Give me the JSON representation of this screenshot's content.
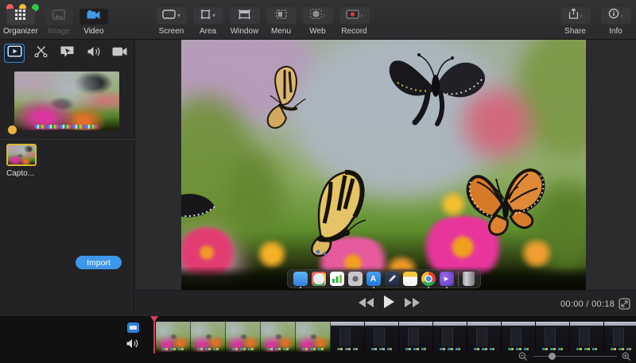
{
  "window": {
    "traffic_lights": {
      "close": "#f5615d",
      "minimize": "#f6bd3b",
      "zoom": "#33c748"
    }
  },
  "toolbar": {
    "tabs": [
      {
        "label": "Organizer",
        "icon": "grid-icon",
        "active": false
      },
      {
        "label": "Image",
        "icon": "image-icon",
        "active": false,
        "disabled": true
      },
      {
        "label": "Video",
        "icon": "video-camera-icon",
        "active": true
      }
    ],
    "capture_buttons": [
      {
        "label": "Screen",
        "icon": "screen-capture-icon",
        "has_dropdown": true
      },
      {
        "label": "Area",
        "icon": "area-capture-icon",
        "has_dropdown": true
      },
      {
        "label": "Window",
        "icon": "window-capture-icon",
        "has_dropdown": false
      },
      {
        "label": "Menu",
        "icon": "menu-capture-icon",
        "has_dropdown": false
      },
      {
        "label": "Web",
        "icon": "web-capture-icon",
        "has_dropdown": true
      },
      {
        "label": "Record",
        "icon": "record-icon",
        "has_dropdown": true
      }
    ],
    "right_buttons": [
      {
        "label": "Share",
        "icon": "share-icon",
        "has_dropdown": true
      },
      {
        "label": "Info",
        "icon": "info-icon",
        "has_dropdown": true
      }
    ]
  },
  "sidebar": {
    "tools": [
      {
        "name": "preview-tool",
        "active": true
      },
      {
        "name": "trim-tool",
        "active": false
      },
      {
        "name": "annotate-tool",
        "active": false
      },
      {
        "name": "audio-tool",
        "active": false
      },
      {
        "name": "camera-tool",
        "active": false
      }
    ],
    "clip": {
      "label": "Capto...",
      "selected": true
    },
    "import_button": "Import"
  },
  "player": {
    "transport": [
      "rewind",
      "play",
      "fast-forward"
    ],
    "time_display": "00:00 / 00:18",
    "fullscreen_icon": "fullscreen-icon"
  },
  "timeline": {
    "tracks": [
      "video-track",
      "audio-track"
    ],
    "playhead_position": "start",
    "zoom_controls": [
      "zoom-out-icon",
      "zoom-slider",
      "zoom-in-icon"
    ]
  },
  "preview_dock_icons": [
    "finder",
    "launchpad",
    "stats",
    "settings",
    "app-store",
    "editor",
    "notes",
    "chrome",
    "capto",
    "trash"
  ],
  "colors": {
    "accent_blue": "#3e97e8",
    "selection_yellow": "#d9b832",
    "playhead_red": "#cf3f52",
    "record_red": "#e03c3c"
  }
}
